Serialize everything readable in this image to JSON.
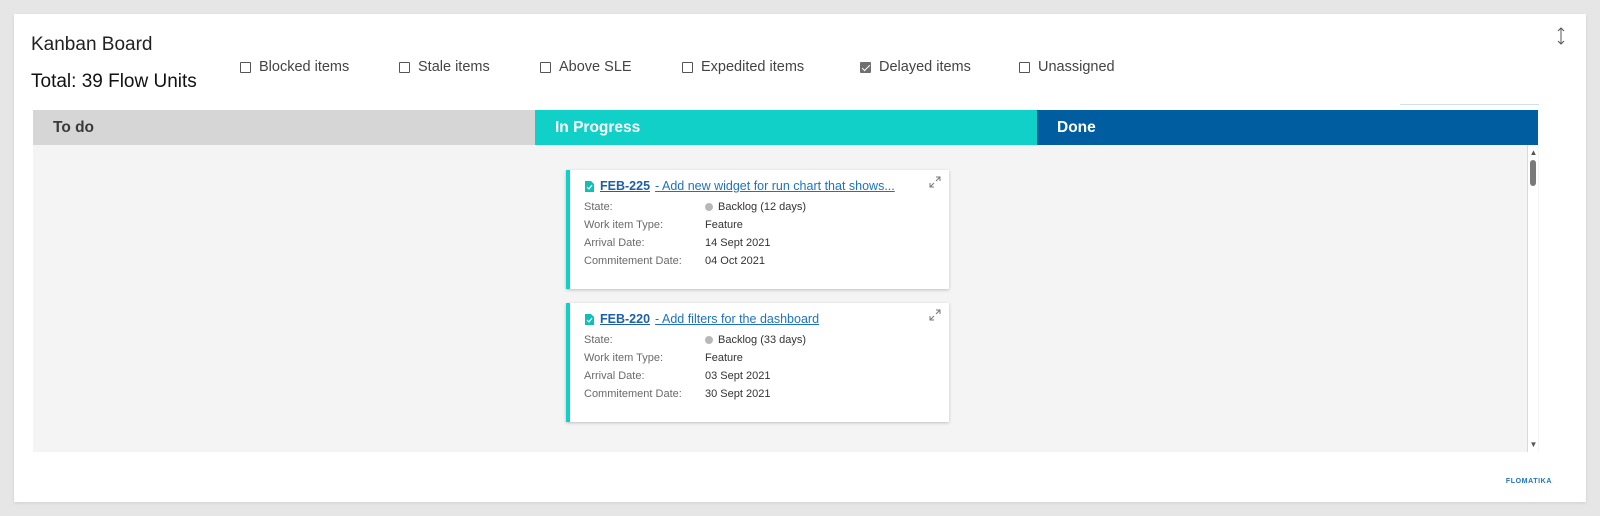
{
  "header": {
    "title": "Kanban Board",
    "total": "Total: 39 Flow Units"
  },
  "filters": [
    {
      "label": "Blocked items",
      "checked": false
    },
    {
      "label": "Stale items",
      "checked": false
    },
    {
      "label": "Above SLE",
      "checked": false
    },
    {
      "label": "Expedited items",
      "checked": false
    },
    {
      "label": "Delayed items",
      "checked": true
    },
    {
      "label": "Unassigned",
      "checked": false
    }
  ],
  "columns": [
    {
      "label": "To do",
      "color": "#d6d6d6"
    },
    {
      "label": "In Progress",
      "color": "#10d0c8"
    },
    {
      "label": "Done",
      "color": "#005ea0"
    }
  ],
  "cards": [
    {
      "id": "FEB-225",
      "title": "- Add new widget for run chart that shows...",
      "fields": [
        {
          "label": "State:",
          "value": "Backlog (12 days)"
        },
        {
          "label": "Work item Type:",
          "value": "Feature"
        },
        {
          "label": "Arrival Date:",
          "value": "14 Sept 2021"
        },
        {
          "label": "Commitement Date:",
          "value": "04 Oct 2021"
        }
      ]
    },
    {
      "id": "FEB-220",
      "title": "- Add filters for the dashboard",
      "fields": [
        {
          "label": "State:",
          "value": "Backlog (33 days)"
        },
        {
          "label": "Work item Type:",
          "value": "Feature"
        },
        {
          "label": "Arrival Date:",
          "value": "03 Sept 2021"
        },
        {
          "label": "Commitement Date:",
          "value": "30 Sept 2021"
        }
      ]
    }
  ],
  "footer": {
    "logo": "FLOMATIKA"
  },
  "colors": {
    "accent_teal": "#10d0c8",
    "accent_blue": "#005ea0",
    "link": "#1d72c6"
  },
  "icons": {
    "resize": "vertical-resize-icon",
    "expand": "expand-icon",
    "card": "document-icon"
  }
}
